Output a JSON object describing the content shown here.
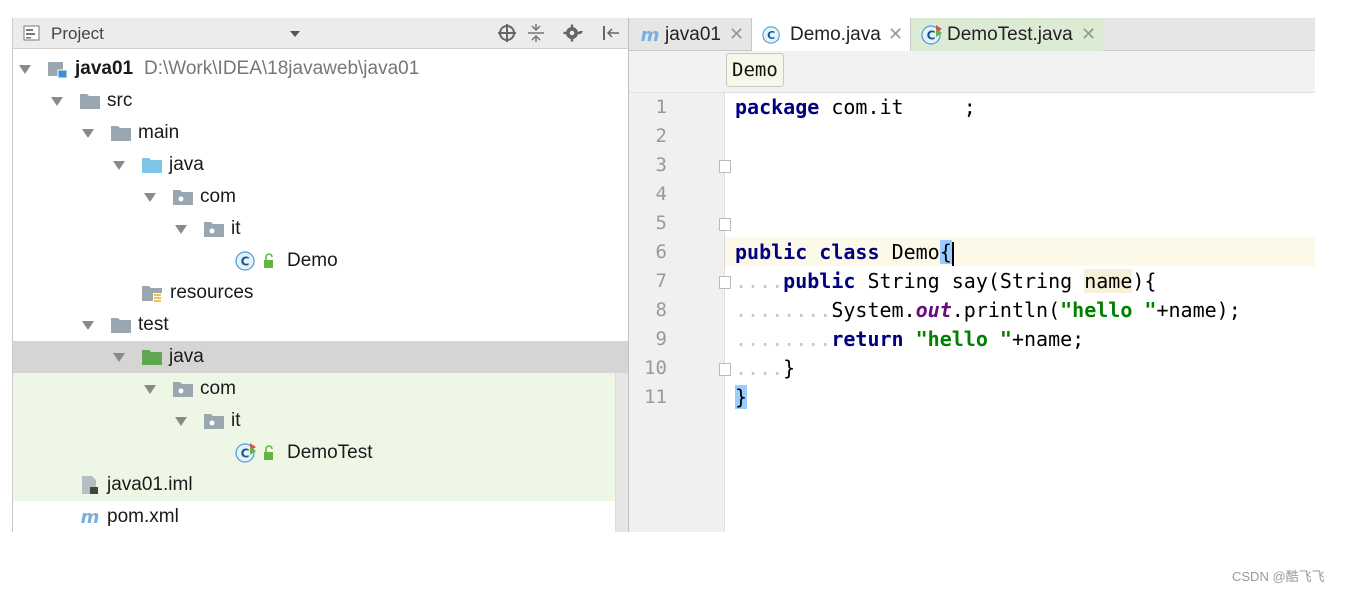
{
  "project": {
    "title": "Project",
    "tree": {
      "root": {
        "name": "java01",
        "path": "D:\\Work\\IDEA\\18javaweb\\java01"
      },
      "src": "src",
      "main": "main",
      "main_java": "java",
      "main_com": "com",
      "main_it": "it",
      "demo": "Demo",
      "resources": "resources",
      "test": "test",
      "test_java": "java",
      "test_com": "com",
      "test_it": "it",
      "demotest": "DemoTest",
      "iml": "java01.iml",
      "pom": "pom.xml"
    }
  },
  "editor": {
    "tabs": [
      {
        "label": "java01",
        "icon": "maven-m-icon"
      },
      {
        "label": "Demo.java",
        "icon": "class-c-icon"
      },
      {
        "label": "DemoTest.java",
        "icon": "test-class-icon"
      }
    ],
    "breadcrumb": "Demo",
    "line_numbers": [
      "1",
      "2",
      "3",
      "4",
      "5",
      "6",
      "7",
      "8",
      "9",
      "10",
      "11"
    ],
    "code": {
      "l1_kw": "package",
      "l1_rest": " com.it     ;",
      "l6_kw1": "public",
      "l6_kw2": "class",
      "l6_name": "Demo",
      "l6_brace": "{",
      "l7_dots": "....",
      "l7_kw": "public",
      "l7_type": "String",
      "l7_method": "say(String ",
      "l7_param": "name",
      "l7_end": "){",
      "l8_dots": "........",
      "l8_sys": "System.",
      "l8_field": "out",
      "l8_call": ".println(",
      "l8_str": "\"hello \"",
      "l8_end": "+name);",
      "l9_dots": "........",
      "l9_kw": "return",
      "l9_str": "\"hello \"",
      "l9_end": "+name;",
      "l10_dots": "....",
      "l10_brace": "}",
      "l11_brace": "}"
    }
  },
  "watermark": "CSDN @酷飞飞",
  "colors": {
    "keyword": "#000080",
    "string": "#008000",
    "field": "#660e7a",
    "caret_line": "#fcf9e8",
    "brace_match": "#99ccff",
    "test_zone": "#eef7e6"
  }
}
